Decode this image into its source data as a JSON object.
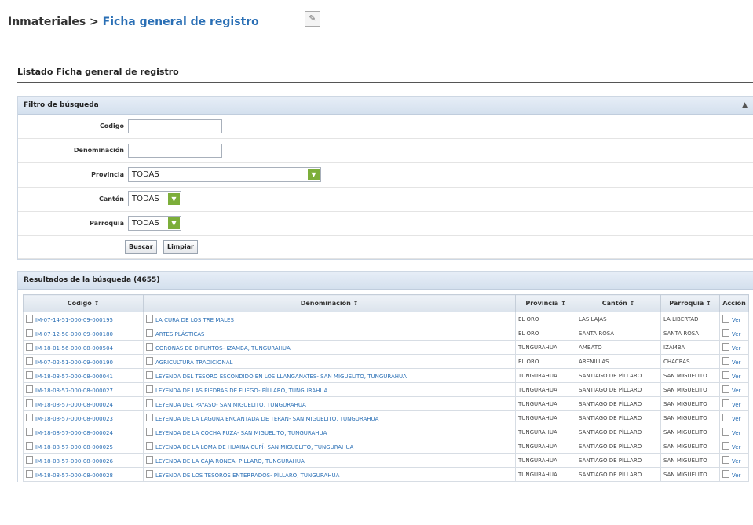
{
  "breadcrumb": {
    "root": "Inmateriales",
    "separator": " > ",
    "current": "Ficha general de registro"
  },
  "listado_title": "Listado Ficha general de registro",
  "filter": {
    "title": "Filtro de búsqueda",
    "codigo_label": "Codigo",
    "denominacion_label": "Denominación",
    "provincia_label": "Provincia",
    "provincia_value": "TODAS",
    "canton_label": "Cantón",
    "canton_value": "TODAS",
    "parroquia_label": "Parroquia",
    "parroquia_value": "TODAS",
    "buscar": "Buscar",
    "limpiar": "Limpiar"
  },
  "results": {
    "title": "Resultados de la búsqueda (4655)",
    "headers": [
      "Codigo ↕",
      "Denominación ↕",
      "Provincia ↕",
      "Cantón ↕",
      "Parroquia ↕",
      "Acción"
    ],
    "rows": [
      [
        "IM-07-14-51-000-09-000195",
        "LA CURA DE LOS TRE MALES",
        "EL ORO",
        "LAS LAJAS",
        "LA LIBERTAD",
        "Ver"
      ],
      [
        "IM-07-12-50-000-09-000180",
        "ARTES PLÁSTICAS",
        "EL ORO",
        "SANTA ROSA",
        "SANTA ROSA",
        "Ver"
      ],
      [
        "IM-18-01-56-000-08-000504",
        "CORONAS DE DIFUNTOS- IZAMBA, TUNGURAHUA",
        "TUNGURAHUA",
        "AMBATO",
        "IZAMBA",
        "Ver"
      ],
      [
        "IM-07-02-51-000-09-000190",
        "AGRICULTURA TRADICIONAL",
        "EL ORO",
        "ARENILLAS",
        "CHACRAS",
        "Ver"
      ],
      [
        "IM-18-08-57-000-08-000041",
        "LEYENDA DEL TESORO ESCONDIDO EN LOS LLANGANATES- SAN MIGUELITO, TUNGURAHUA",
        "TUNGURAHUA",
        "SANTIAGO DE PÍLLARO",
        "SAN MIGUELITO",
        "Ver"
      ],
      [
        "IM-18-08-57-000-08-000027",
        "LEYENDA DE LAS PIEDRAS DE FUEGO- PÍLLARO, TUNGURAHUA",
        "TUNGURAHUA",
        "SANTIAGO DE PÍLLARO",
        "SAN MIGUELITO",
        "Ver"
      ],
      [
        "IM-18-08-57-000-08-000024",
        "LEYENDA DEL PAYASO- SAN MIGUELITO, TUNGURAHUA",
        "TUNGURAHUA",
        "SANTIAGO DE PÍLLARO",
        "SAN MIGUELITO",
        "Ver"
      ],
      [
        "IM-18-08-57-000-08-000023",
        "LEYENDA DE LA LAGUNA ENCANTADA DE TERÁN- SAN MIGUELITO, TUNGURAHUA",
        "TUNGURAHUA",
        "SANTIAGO DE PÍLLARO",
        "SAN MIGUELITO",
        "Ver"
      ],
      [
        "IM-18-08-57-000-08-000024",
        "LEYENDA DE LA COCHA PUZA- SAN MIGUELITO, TUNGURAHUA",
        "TUNGURAHUA",
        "SANTIAGO DE PÍLLARO",
        "SAN MIGUELITO",
        "Ver"
      ],
      [
        "IM-18-08-57-000-08-000025",
        "LEYENDA DE LA LOMA DE HUAINA CUPÍ- SAN MIGUELITO, TUNGURAHUA",
        "TUNGURAHUA",
        "SANTIAGO DE PÍLLARO",
        "SAN MIGUELITO",
        "Ver"
      ],
      [
        "IM-18-08-57-000-08-000026",
        "LEYENDA DE LA CAJA RONCA- PÍLLARO, TUNGURAHUA",
        "TUNGURAHUA",
        "SANTIAGO DE PÍLLARO",
        "SAN MIGUELITO",
        "Ver"
      ],
      [
        "IM-18-08-57-000-08-000028",
        "LEYENDA DE LOS TESOROS ENTERRADOS- PÍLLARO, TUNGURAHUA",
        "TUNGURAHUA",
        "SANTIAGO DE PÍLLARO",
        "SAN MIGUELITO",
        "Ver"
      ]
    ]
  }
}
